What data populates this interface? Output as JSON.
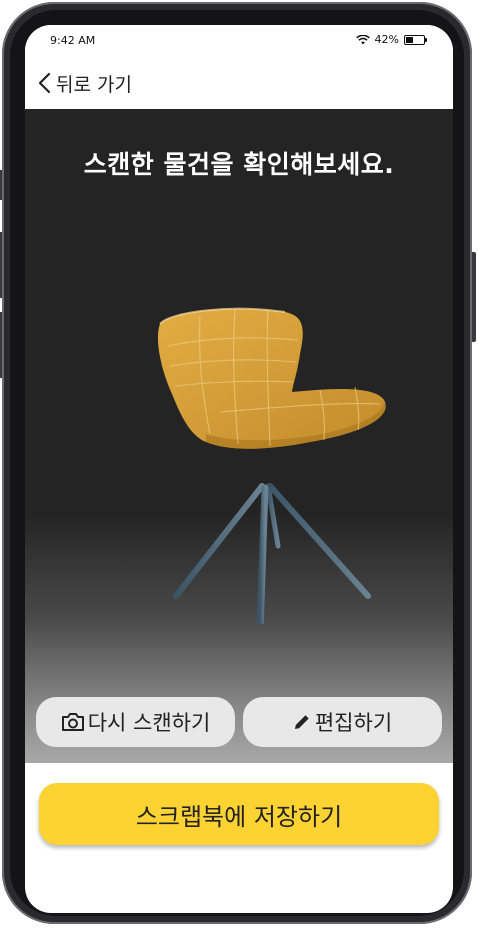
{
  "status_bar": {
    "time": "9:42 AM",
    "battery_text": "42%",
    "battery_level": 0.42,
    "icons": [
      "wifi-icon",
      "battery-icon"
    ]
  },
  "nav": {
    "back_label": "뒤로 가기",
    "back_icon": "chevron-left-icon"
  },
  "scan": {
    "title": "스캔한 물건을 확인해보세요.",
    "preview_object": "chair-3d-model"
  },
  "actions": {
    "rescan_label": "다시 스캔하기",
    "rescan_icon": "camera-icon",
    "edit_label": "편집하기",
    "edit_icon": "pencil-icon"
  },
  "save": {
    "label": "스크랩북에 저장하기"
  },
  "colors": {
    "accent": "#fdd333",
    "scan_background": "#242424",
    "chair": "#d9a238",
    "secondary_button": "#e8e8e8"
  }
}
